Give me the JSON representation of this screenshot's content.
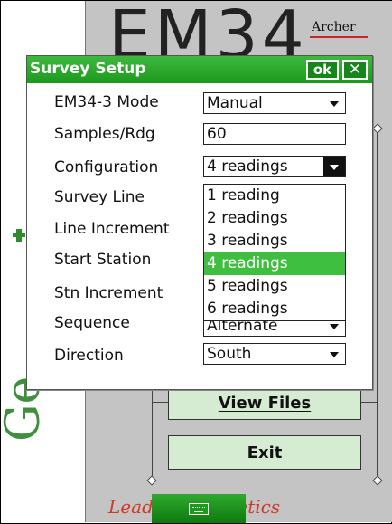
{
  "background": {
    "app_title": "EM34",
    "brand": "Archer",
    "side_brand": "Ge",
    "tagline": "Lead           tromagnetics",
    "buttons": {
      "view_files": "View Files",
      "exit": "Exit"
    }
  },
  "dialog": {
    "title": "Survey Setup",
    "ok_label": "ok",
    "close_label": "✕",
    "fields": [
      {
        "label": "EM34-3 Mode",
        "value": "Manual"
      },
      {
        "label": "Samples/Rdg",
        "value": "60"
      },
      {
        "label": "Configuration",
        "value": "4 readings"
      },
      {
        "label": "Survey Line",
        "value": ""
      },
      {
        "label": "Line Increment",
        "value": ""
      },
      {
        "label": "Start Station",
        "value": ""
      },
      {
        "label": "Stn Increment",
        "value": ""
      },
      {
        "label": "Sequence",
        "value": "Alternate"
      },
      {
        "label": "Direction",
        "value": "South"
      }
    ],
    "configuration_options": [
      "1 reading",
      "2 readings",
      "3 readings",
      "4 readings",
      "5 readings",
      "6 readings"
    ],
    "selected_option_index": 3
  },
  "taskbar": {
    "icon": "keyboard-icon"
  },
  "colors": {
    "accent_green": "#2fa92f",
    "tagline_red": "#cc3b2a"
  }
}
